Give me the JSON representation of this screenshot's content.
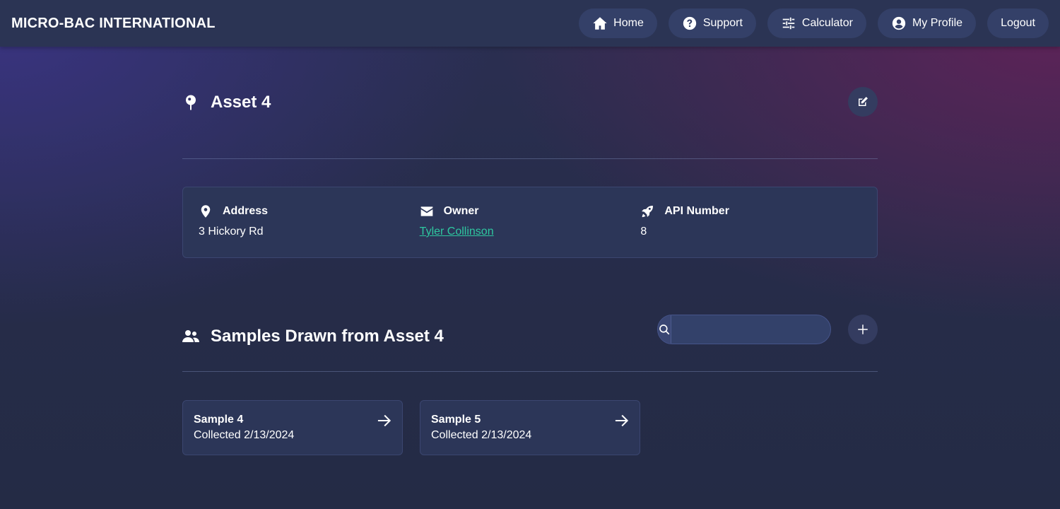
{
  "header": {
    "brand": "MICRO-BAC INTERNATIONAL",
    "nav": {
      "home": "Home",
      "support": "Support",
      "calculator": "Calculator",
      "profile": "My Profile",
      "logout": "Logout"
    }
  },
  "asset": {
    "title": "Asset 4",
    "address_label": "Address",
    "address_value": "3 Hickory Rd",
    "owner_label": "Owner",
    "owner_value": "Tyler Collinson",
    "api_label": "API Number",
    "api_value": "8"
  },
  "samples": {
    "title": "Samples Drawn from Asset 4",
    "search_placeholder": "",
    "items": [
      {
        "name": "Sample 4",
        "collected": "Collected 2/13/2024"
      },
      {
        "name": "Sample 5",
        "collected": "Collected 2/13/2024"
      }
    ]
  },
  "colors": {
    "header_bg": "#2b3454",
    "card_bg": "#2c3658",
    "link": "#2ec8a0"
  },
  "icons": [
    "home-icon",
    "question-circle-icon",
    "sliders-icon",
    "user-circle-icon",
    "map-pin-icon",
    "edit-icon",
    "location-marker-icon",
    "envelope-icon",
    "rocket-icon",
    "users-icon",
    "search-icon",
    "plus-icon",
    "arrow-right-icon"
  ]
}
